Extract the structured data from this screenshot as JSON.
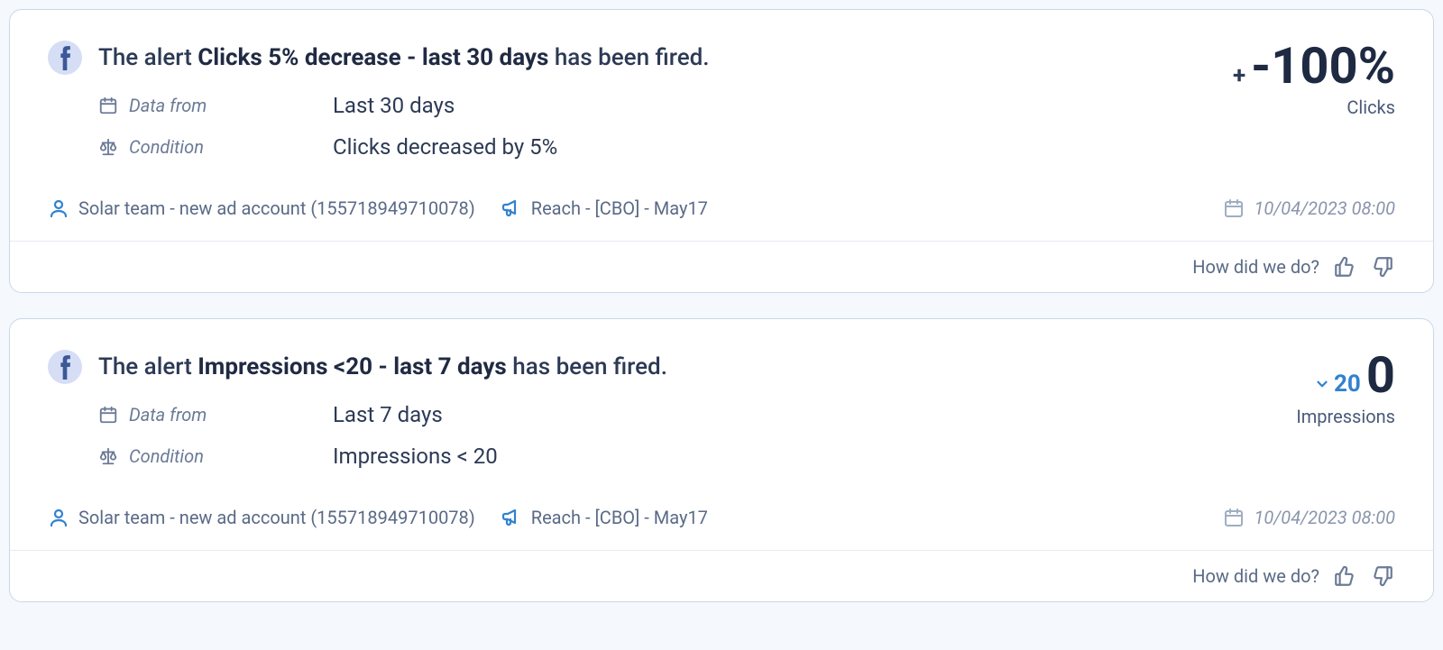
{
  "alerts": [
    {
      "title_prefix": "The alert ",
      "title_name": "Clicks 5% decrease - last 30 days",
      "title_suffix": " has been fired.",
      "data_from_label": "Data from",
      "data_from_value": "Last 30 days",
      "condition_label": "Condition",
      "condition_value": "Clicks decreased by 5%",
      "metric_prefix": "+",
      "metric_value": "-100%",
      "metric_label": "Clicks",
      "prefix_style": "dark",
      "account": "Solar team - new ad account (155718949710078)",
      "campaign": "Reach - [CBO] - May17",
      "timestamp": "10/04/2023 08:00",
      "feedback_label": "How did we do?"
    },
    {
      "title_prefix": "The alert ",
      "title_name": "Impressions <20 - last 7 days",
      "title_suffix": " has been fired.",
      "data_from_label": "Data from",
      "data_from_value": "Last 7 days",
      "condition_label": "Condition",
      "condition_value": "Impressions < 20",
      "metric_prefix": "20",
      "metric_value": "0",
      "metric_label": "Impressions",
      "prefix_style": "blue",
      "account": "Solar team - new ad account (155718949710078)",
      "campaign": "Reach - [CBO] - May17",
      "timestamp": "10/04/2023 08:00",
      "feedback_label": "How did we do?"
    }
  ]
}
